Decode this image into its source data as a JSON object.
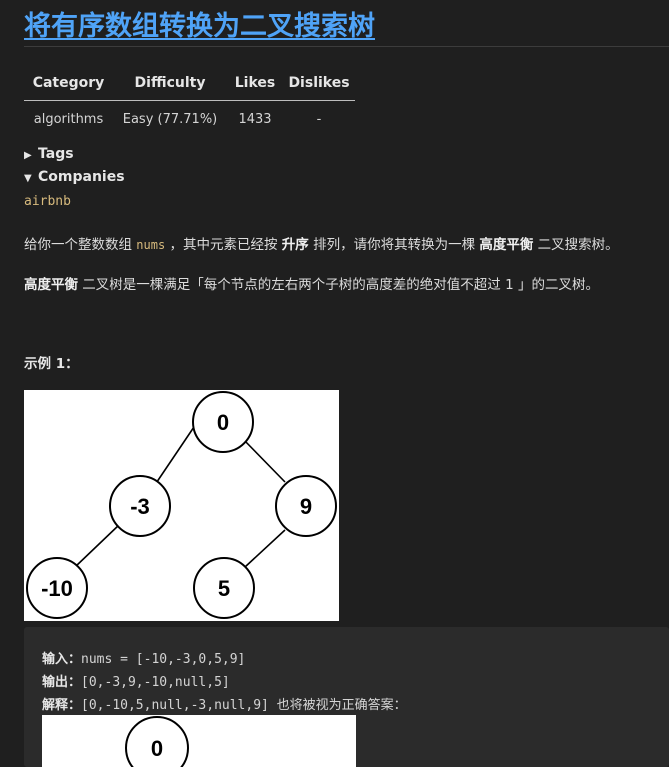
{
  "problem": {
    "title": "将有序数组转换为二叉搜索树"
  },
  "meta_table": {
    "headers": [
      "Category",
      "Difficulty",
      "Likes",
      "Dislikes"
    ],
    "row": [
      "algorithms",
      "Easy (77.71%)",
      "1433",
      "-"
    ]
  },
  "tags_label": "Tags",
  "companies_label": "Companies",
  "companies": [
    "airbnb"
  ],
  "description": {
    "p1_before": "给你一个整数数组 ",
    "p1_code": "nums",
    "p1_mid": " ，其中元素已经按 ",
    "p1_bold1": "升序",
    "p1_mid2": " 排列，请你将其转换为一棵 ",
    "p1_bold2": "高度平衡",
    "p1_after": " 二叉搜索树。",
    "p2_bold": "高度平衡",
    "p2_after": " 二叉树是一棵满足「每个节点的左右两个子树的高度差的绝对值不超过 1 」的二叉树。"
  },
  "example1": {
    "title": "示例 1：",
    "tree1_nodes": [
      "0",
      "-3",
      "9",
      "-10",
      "5"
    ],
    "tree2_nodes": [
      "0"
    ],
    "input_label": "输入：",
    "input_value": "nums = [-10,-3,0,5,9]",
    "output_label": "输出：",
    "output_value": "[0,-3,9,-10,null,5]",
    "explain_label": "解释：",
    "explain_value": "[0,-10,5,null,-3,null,9] 也将被视为正确答案："
  }
}
